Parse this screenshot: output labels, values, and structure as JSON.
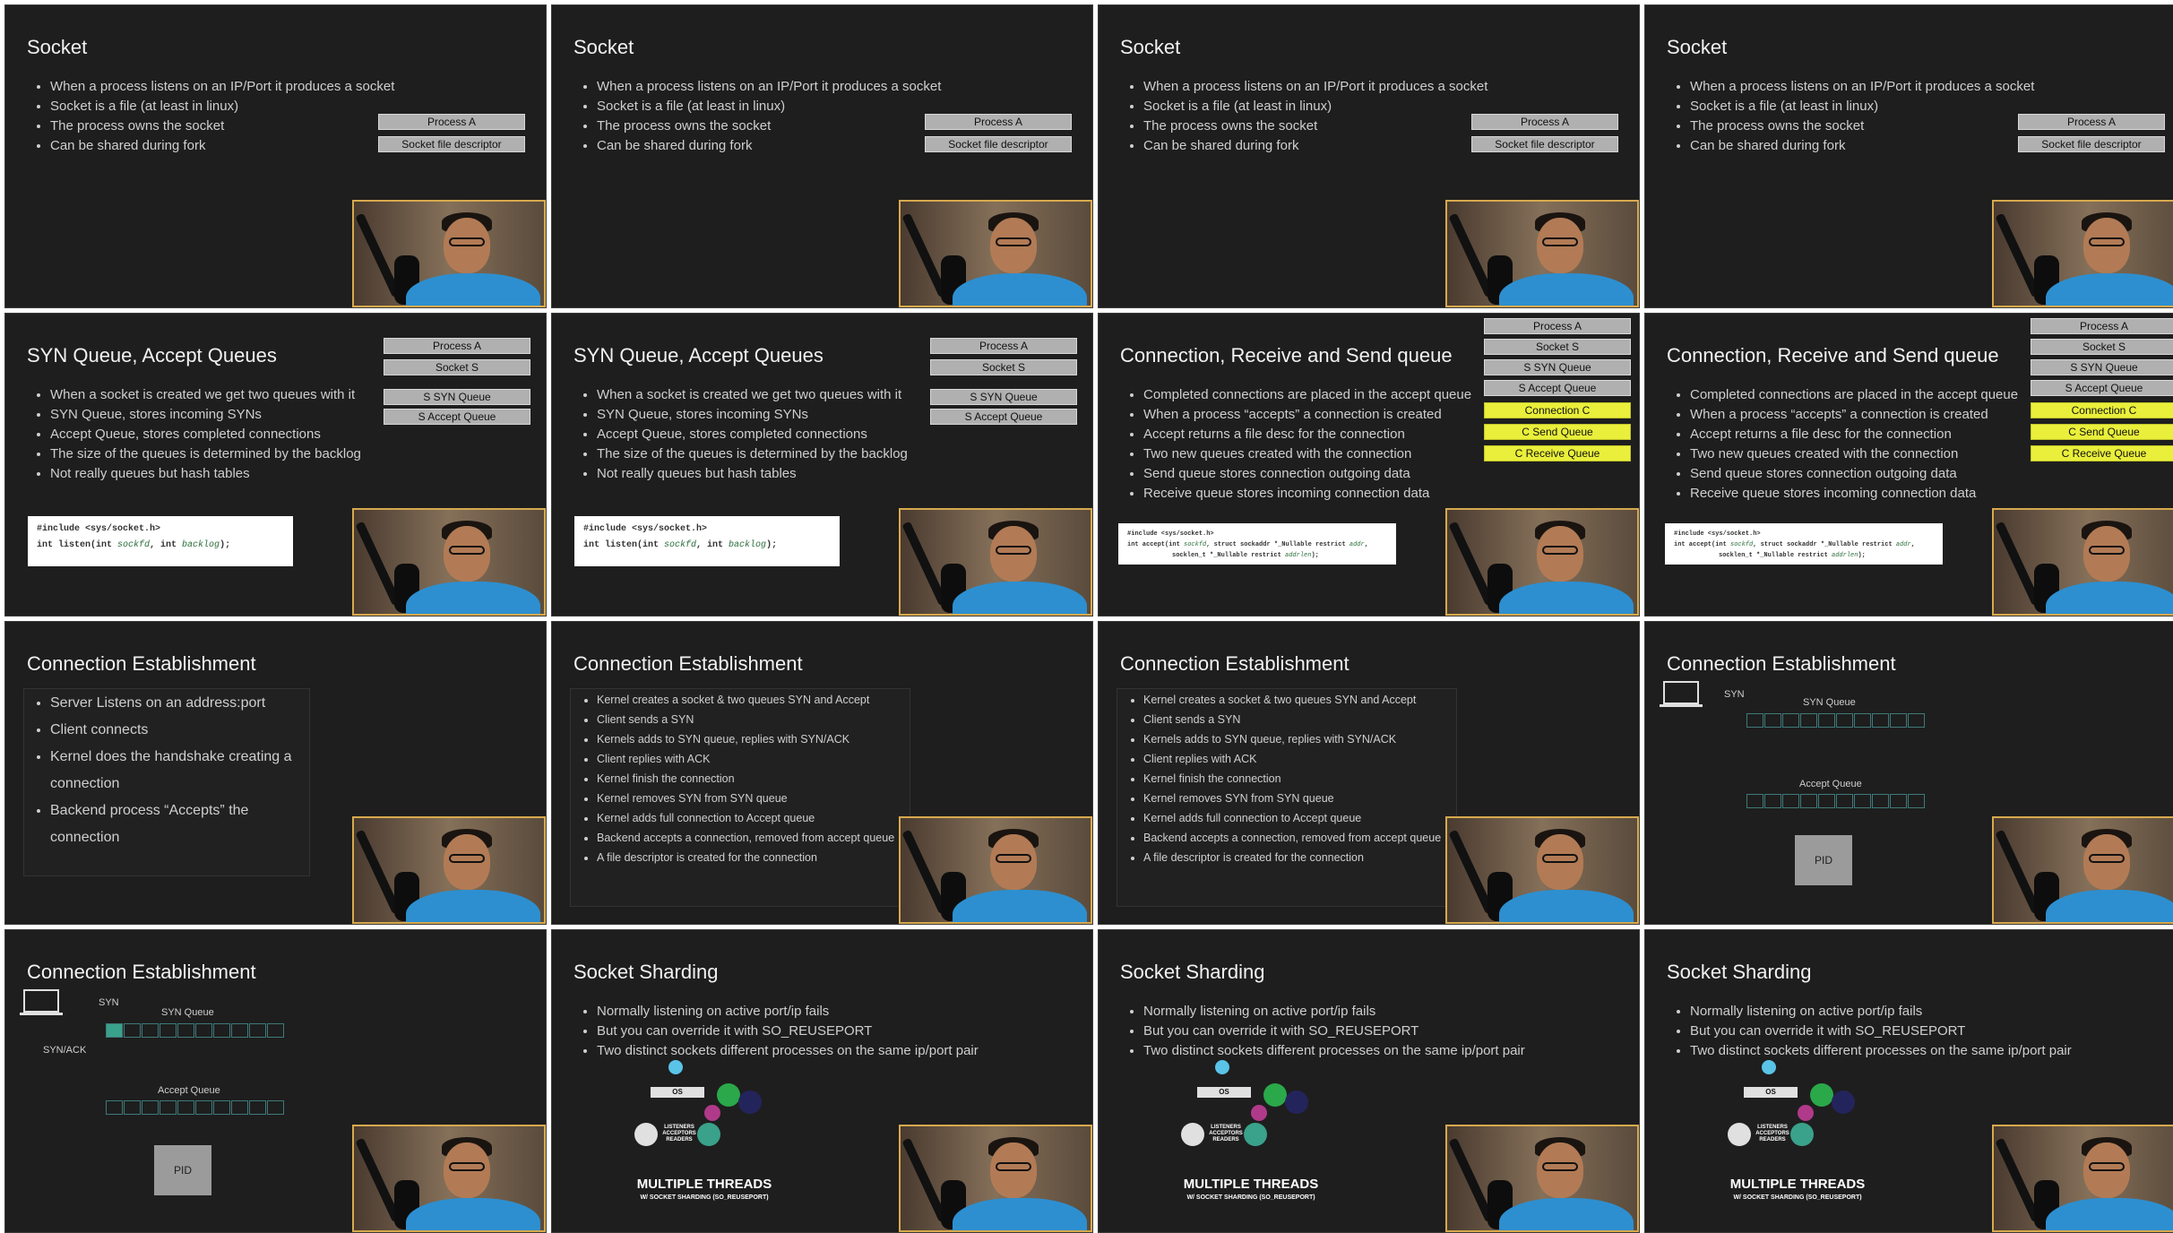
{
  "slides": {
    "socket": {
      "title": "Socket",
      "bullets": [
        "When a process listens on an IP/Port it produces a socket",
        "Socket is a file (at least in linux)",
        "The process owns the socket",
        "Can be shared during fork"
      ],
      "boxes": [
        "Process A",
        "Socket file descriptor"
      ]
    },
    "syn_queue": {
      "title": "SYN Queue, Accept Queues",
      "bullets": [
        "When a socket is created we get two queues with it",
        "SYN Queue, stores incoming SYNs",
        "Accept Queue, stores completed connections",
        "The size of the queues is determined by the backlog",
        "Not really queues but hash tables"
      ],
      "boxes": [
        "Process A",
        "Socket S",
        "S SYN Queue",
        "S Accept Queue"
      ],
      "code_line1": "#include <sys/socket.h>",
      "code_line2_a": "int listen(int ",
      "code_line2_b": "sockfd",
      "code_line2_c": ", int ",
      "code_line2_d": "backlog",
      "code_line2_e": ");"
    },
    "conn_queue": {
      "title": "Connection, Receive and Send queue",
      "bullets": [
        "Completed connections are placed in the accept queue",
        "When a process “accepts” a connection is created",
        "Accept returns a file desc for the connection",
        "Two new queues created with the connection",
        "Send queue stores connection outgoing data",
        "Receive queue stores incoming connection data"
      ],
      "boxes": [
        "Process A",
        "Socket S",
        "S SYN Queue",
        "S Accept Queue"
      ],
      "yellow_boxes": [
        "Connection C",
        "C Send Queue",
        "C Receive Queue"
      ],
      "code_line1": "#include <sys/socket.h>",
      "code_line2_a": "int accept(int ",
      "code_line2_b": "sockfd",
      "code_line2_c": ", struct sockaddr *_Nullable restrict ",
      "code_line2_d": "addr",
      "code_line2_e": ",",
      "code_line3_a": "socklen_t *_Nullable restrict ",
      "code_line3_b": "addrlen",
      "code_line3_c": ");"
    },
    "conn_est": {
      "title": "Connection Establishment",
      "bullets_big": [
        "Server Listens on an address:port",
        "Client connects",
        "Kernel does the handshake creating a connection",
        "Backend process “Accepts” the connection"
      ],
      "bullets_small": [
        "Kernel creates a socket & two queues SYN and Accept",
        "Client sends a SYN",
        "Kernels adds to SYN queue, replies with SYN/ACK",
        "Client replies with ACK",
        "Kernel finish the connection",
        "Kernel removes SYN from SYN queue",
        "Kernel adds full connection to Accept queue",
        "Backend accepts a connection, removed from accept queue",
        "A file descriptor is created for the connection"
      ],
      "diagram": {
        "syn": "SYN",
        "syn_ack": "SYN/ACK",
        "syn_queue": "SYN Queue",
        "accept_queue": "Accept Queue",
        "pid": "PID"
      }
    },
    "sharding": {
      "title": "Socket Sharding",
      "bullets": [
        "Normally listening on active port/ip fails",
        "But you can override it with SO_REUSEPORT",
        "Two distinct sockets different processes on the same ip/port pair"
      ],
      "os_label": "OS",
      "listeners": "LISTENERS ACCEPTORS READERS",
      "caption_main": "MULTIPLE THREADS",
      "caption_sub": "W/ SOCKET SHARDING (SO_REUSEPORT)"
    }
  },
  "colors": {
    "slide_bg": "#1e1e1e",
    "accent_yellow": "#e9ef3a",
    "queue_teal": "#3aa18a",
    "webcam_border": "#d7a94d"
  }
}
